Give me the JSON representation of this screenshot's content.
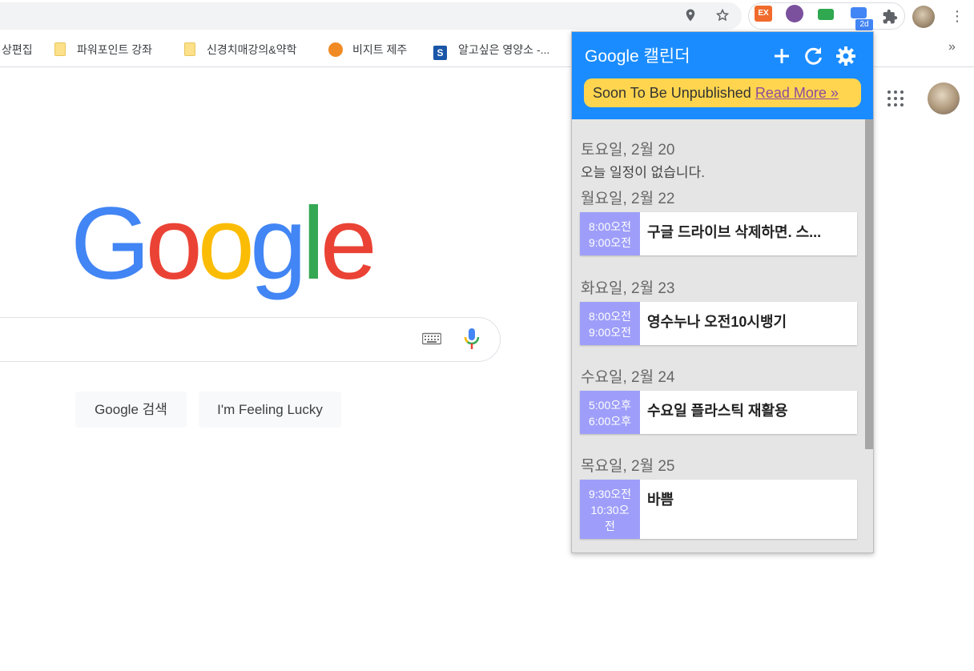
{
  "browser": {
    "icons": [
      "location-icon",
      "star-icon",
      "puzzle-icon",
      "kebab-icon"
    ],
    "extensions": [
      {
        "name": "ex-extension",
        "label": "EX",
        "color": "#f06b2c"
      },
      {
        "name": "viber-extension",
        "label": "",
        "color": "#7b519d"
      },
      {
        "name": "screen-extension",
        "label": "",
        "color": "#2fa84f"
      },
      {
        "name": "calendar-extension",
        "label": "",
        "color": "#4285f4"
      }
    ],
    "calendar_badge": "2d"
  },
  "bookmarks": [
    {
      "label": "상편집",
      "icon": "none"
    },
    {
      "label": "파워포인트 강좌",
      "icon": "folder-icon"
    },
    {
      "label": "신경치매강의&약학",
      "icon": "folder-icon"
    },
    {
      "label": "비지트 제주",
      "icon": "visit-jeju-icon"
    },
    {
      "label": "알고싶은 영양소 -...",
      "icon": "s-icon"
    }
  ],
  "bookmarks_more": "»",
  "google": {
    "logo_letters": [
      "G",
      "o",
      "o",
      "g",
      "l",
      "e"
    ],
    "logo_colors": [
      "#4285f4",
      "#ea4335",
      "#fbbc05",
      "#4285f4",
      "#34a853",
      "#ea4335"
    ],
    "search_button": "Google 검색",
    "lucky_button": "I'm Feeling Lucky"
  },
  "calendar": {
    "title": "Google 캘린더",
    "notice_text": "Soon To Be Unpublished ",
    "notice_link": "Read More »",
    "days": [
      {
        "header": "토요일, 2월 20",
        "no_events": "오늘 일정이 없습니다."
      },
      {
        "header": "월요일, 2월 22",
        "events": [
          {
            "start": "8:00오전",
            "end": "9:00오전",
            "title": "구글 드라이브 삭제하면. 스..."
          }
        ]
      },
      {
        "header": "화요일, 2월 23",
        "events": [
          {
            "start": "8:00오전",
            "end": "9:00오전",
            "title": "영수누나 오전10시뱅기"
          }
        ]
      },
      {
        "header": "수요일, 2월 24",
        "events": [
          {
            "start": "5:00오후",
            "end": "6:00오후",
            "title": "수요일 플라스틱 재활용"
          }
        ]
      },
      {
        "header": "목요일, 2월 25",
        "events": [
          {
            "start": "9:30오전",
            "end": "10:30오전",
            "title": "바쁨"
          }
        ]
      }
    ]
  }
}
